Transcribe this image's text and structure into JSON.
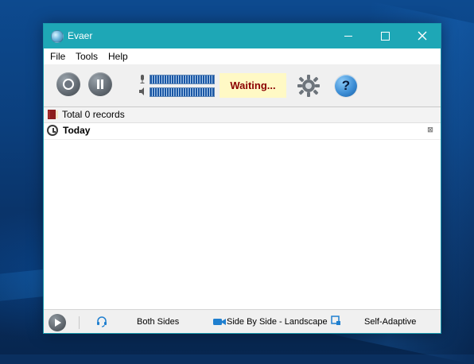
{
  "window": {
    "title": "Evaer"
  },
  "menubar": {
    "items": [
      "File",
      "Tools",
      "Help"
    ]
  },
  "toolbar": {
    "status": "Waiting..."
  },
  "list": {
    "summary": "Total 0 records",
    "group_label": "Today"
  },
  "statusbar": {
    "audio_mode": "Both Sides",
    "video_layout": "Side By Side - Landscape",
    "resolution": "Self-Adaptive"
  },
  "colors": {
    "titlebar": "#1ea7b6",
    "status_bg": "#fff9c5",
    "status_text": "#8b0000",
    "meter_fill": "#1a57a5"
  },
  "icons": {
    "app": "evaer-app-icon",
    "record": "record-icon",
    "pause": "pause-icon",
    "microphone": "microphone-icon",
    "speaker": "speaker-icon",
    "settings": "gear-icon",
    "help": "help-icon",
    "records": "book-icon",
    "today": "clock-icon",
    "clear": "close-icon",
    "play": "play-icon",
    "audio": "headset-icon",
    "video": "video-camera-icon",
    "resolution": "screen-capture-icon"
  }
}
